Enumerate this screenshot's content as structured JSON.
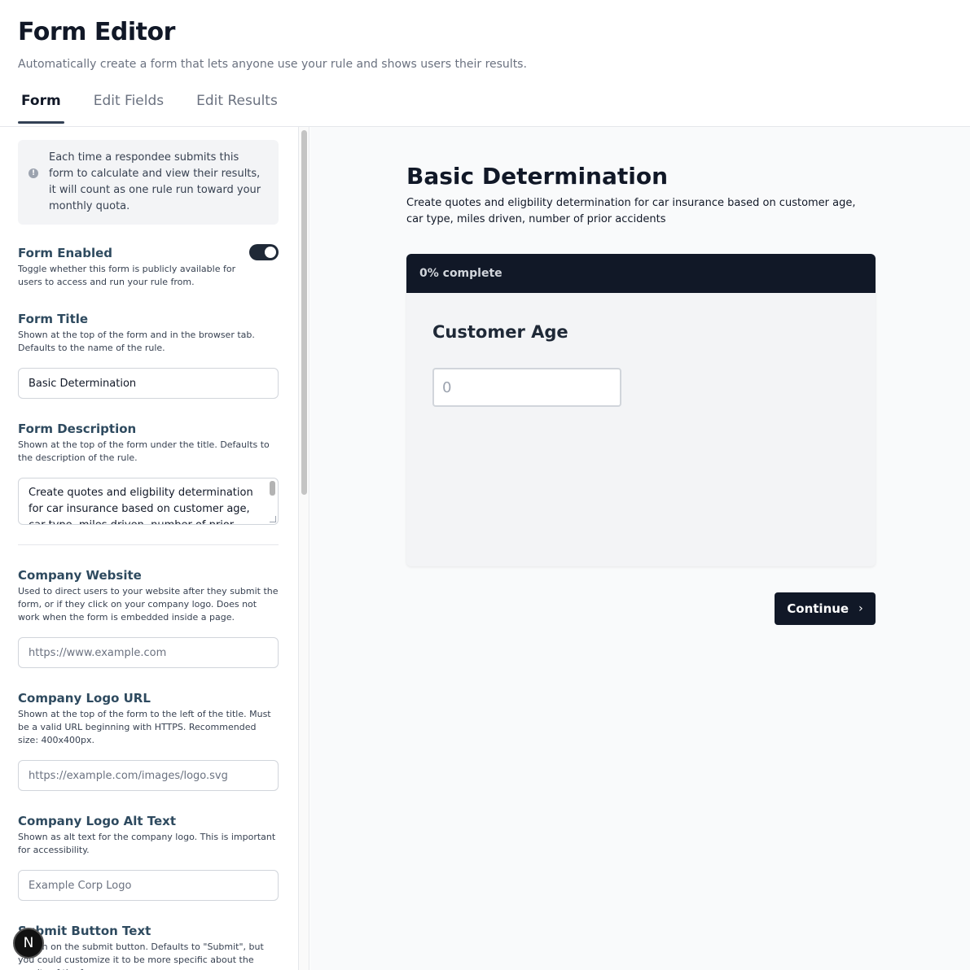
{
  "header": {
    "title": "Form Editor",
    "subtitle": "Automatically create a form that lets anyone use your rule and shows users their results."
  },
  "tabs": [
    {
      "label": "Form",
      "active": true
    },
    {
      "label": "Edit Fields",
      "active": false
    },
    {
      "label": "Edit Results",
      "active": false
    }
  ],
  "settings": {
    "info_text": "Each time a respondee submits this form to calculate and view their results, it will count as one rule run toward your monthly quota.",
    "info_icon": "info-icon",
    "form_enabled": {
      "title": "Form Enabled",
      "help": "Toggle whether this form is publicly available for users to access and run your rule from.",
      "value": true
    },
    "form_title": {
      "title": "Form Title",
      "help": "Shown at the top of the form and in the browser tab. Defaults to the name of the rule.",
      "value": "Basic Determination"
    },
    "form_description": {
      "title": "Form Description",
      "help": "Shown at the top of the form under the title. Defaults to the description of the rule.",
      "value": "Create quotes and eligbility determination for car insurance based on customer age, car type, miles driven, number of prior accidents"
    },
    "company_website": {
      "title": "Company Website",
      "help": "Used to direct users to your website after they submit the form, or if they click on your company logo. Does not work when the form is embedded inside a page.",
      "placeholder": "https://www.example.com"
    },
    "company_logo_url": {
      "title": "Company Logo URL",
      "help": "Shown at the top of the form to the left of the title. Must be a valid URL beginning with HTTPS. Recommended size: 400x400px.",
      "placeholder": "https://example.com/images/logo.svg"
    },
    "company_logo_alt": {
      "title": "Company Logo Alt Text",
      "help": "Shown as alt text for the company logo. This is important for accessibility.",
      "placeholder": "Example Corp Logo"
    },
    "submit_button_text": {
      "title": "Submit Button Text",
      "help": "Shown on the submit button. Defaults to \"Submit\", but you could customize it to be more specific about the results of the form."
    }
  },
  "preview": {
    "title": "Basic Determination",
    "description": "Create quotes and eligbility determination for car insurance based on customer age, car type, miles driven, number of prior accidents",
    "progress_text": "0% complete",
    "progress_fraction": 0,
    "question_label": "Customer Age",
    "age_placeholder": "0",
    "continue_label": "Continue",
    "continue_icon": "chevron-right-icon"
  },
  "badge": {
    "letter": "N"
  },
  "colors": {
    "dark": "#111827",
    "field_title": "#2e4a5f",
    "preview_bg": "#f9fafb"
  }
}
